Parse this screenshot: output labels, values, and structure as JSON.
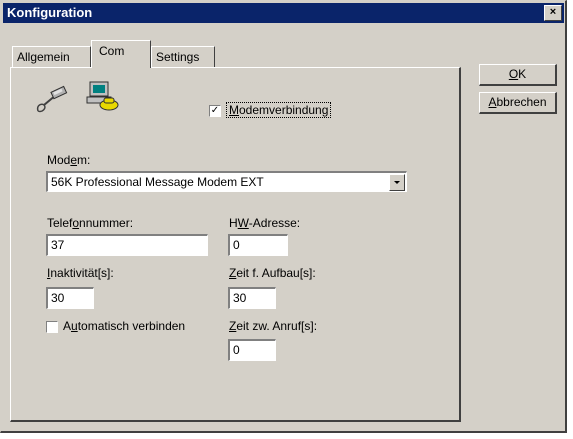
{
  "window": {
    "title": "Konfiguration",
    "close_glyph": "×"
  },
  "tabs": [
    {
      "label": "Allgemein"
    },
    {
      "label": "Com",
      "active": true
    },
    {
      "label": "Settings"
    }
  ],
  "buttons": {
    "ok_pre": "",
    "ok_mn": "O",
    "ok_post": "K",
    "abbrechen_pre": "",
    "abbrechen_mn": "A",
    "abbrechen_post": "bbrechen"
  },
  "icons": {
    "cable": "serial-cable-icon",
    "computer": "computer-phone-icon"
  },
  "modemverbindung": {
    "checked": true,
    "mark": "✓",
    "pre": "",
    "mn": "M",
    "post": "odemverbindung"
  },
  "modem": {
    "label_pre": "Mod",
    "label_mn": "e",
    "label_post": "m:",
    "selected": "56K Professional Message Modem EXT"
  },
  "telefonnummer": {
    "label_pre": "Telef",
    "label_mn": "o",
    "label_post": "nnummer:",
    "value": "37"
  },
  "hw_adresse": {
    "label_pre": "H",
    "label_mn": "W",
    "label_post": "-Adresse:",
    "value": "0"
  },
  "inaktivitaet": {
    "label_pre": "",
    "label_mn": "I",
    "label_post": "naktivität[s]:",
    "value": "30"
  },
  "zeit_aufbau": {
    "label_pre": "",
    "label_mn": "Z",
    "label_post": "eit f. Aufbau[s]:",
    "value": "30"
  },
  "automatisch": {
    "checked": false,
    "mark": "",
    "pre": "A",
    "mn": "u",
    "post": "tomatisch verbinden"
  },
  "zeit_anruf": {
    "label_pre": "",
    "label_mn": "Z",
    "label_post": "eit zw. Anruf[s]:",
    "value": "0"
  },
  "colors": {
    "titlebar": "#0a246a",
    "face": "#d4d0c8"
  }
}
